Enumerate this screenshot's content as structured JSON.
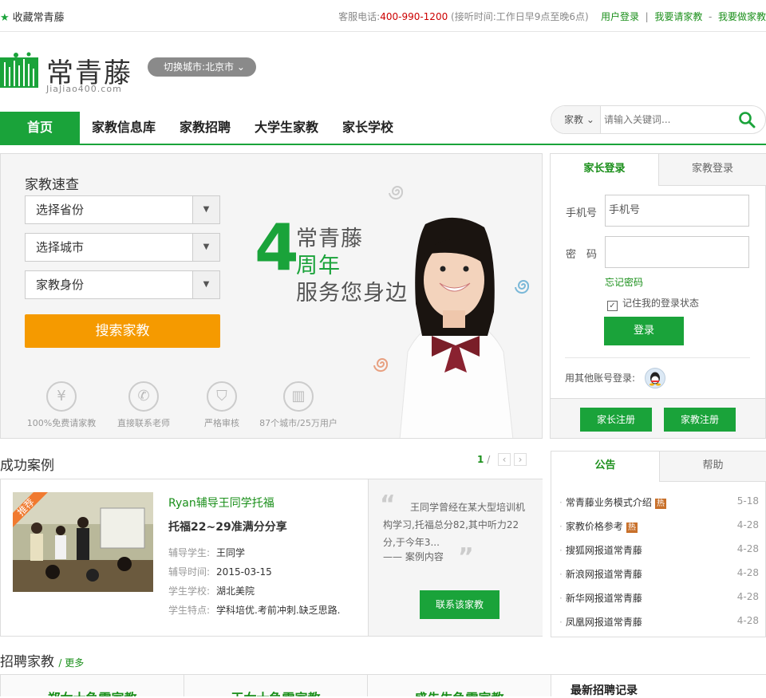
{
  "topbar": {
    "favorite": "收藏常青藤",
    "phone_label": "客服电话:",
    "phone": "400-990-1200",
    "hours": "(接听时间:工作日早9点至晚6点)",
    "user_login": "用户登录",
    "sep1": "|",
    "hire_tutor": "我要请家教",
    "sep2": "-",
    "be_tutor": "我要做家教"
  },
  "header": {
    "logo_text": "常青藤",
    "logo_sub": "JiaJiao400.com",
    "city_switch": "切换城市:北京市"
  },
  "nav": {
    "items": [
      "首页",
      "家教信息库",
      "家教招聘",
      "大学生家教",
      "家长学校"
    ]
  },
  "search": {
    "type": "家教",
    "placeholder": "请输入关键词..."
  },
  "quick": {
    "title": "家教速查",
    "province": "选择省份",
    "city": "选择城市",
    "identity": "家教身份",
    "button": "搜索家教",
    "features": [
      "100%免费请家教",
      "直接联系老师",
      "严格审核",
      "87个城市/25万用户"
    ],
    "banner_num": "4",
    "banner_l1": "常青藤",
    "banner_l2": "周年",
    "banner_l3": "服务您身边"
  },
  "login": {
    "tab_parent": "家长登录",
    "tab_tutor": "家教登录",
    "phone_label": "手机号",
    "phone_value": "手机号",
    "pwd_label": "密　码",
    "forgot": "忘记密码",
    "remember": "记住我的登录状态",
    "button": "登录",
    "other": "用其他账号登录:",
    "reg_parent": "家长注册",
    "reg_tutor": "家教注册"
  },
  "cases": {
    "title": "成功案例",
    "page": "1",
    "page_sep": "/",
    "badge": "推荐",
    "name": "Ryan辅导王同学托福",
    "headline": "托福22~29准满分分享",
    "rows": [
      {
        "label": "辅导学生:",
        "value": "王同学"
      },
      {
        "label": "辅导时间:",
        "value": "2015-03-15"
      },
      {
        "label": "学生学校:",
        "value": "湖北美院"
      },
      {
        "label": "学生特点:",
        "value": "学科培优.考前冲刺.缺乏思路."
      }
    ],
    "quote": "王同学曾经在某大型培训机构学习,托福总分82,其中听力22分,于今年3...",
    "quote_src": "—— 案例内容",
    "contact": "联系该家教"
  },
  "notice": {
    "tab1": "公告",
    "tab2": "帮助",
    "items": [
      {
        "title": "常青藤业务模式介绍",
        "hot": "热",
        "date": "5-18"
      },
      {
        "title": "家教价格参考",
        "hot": "热",
        "date": "4-28"
      },
      {
        "title": "搜狐网报道常青藤",
        "hot": "",
        "date": "4-28"
      },
      {
        "title": "新浪网报道常青藤",
        "hot": "",
        "date": "4-28"
      },
      {
        "title": "新华网报道常青藤",
        "hot": "",
        "date": "4-28"
      },
      {
        "title": "凤凰网报道常青藤",
        "hot": "",
        "date": "4-28"
      }
    ]
  },
  "recruit": {
    "title": "招聘家教",
    "more": "更多",
    "cols": [
      "郑女士急需家教",
      "王女士急需家教",
      "盛先生急需家教"
    ],
    "latest": "最新招聘记录"
  }
}
